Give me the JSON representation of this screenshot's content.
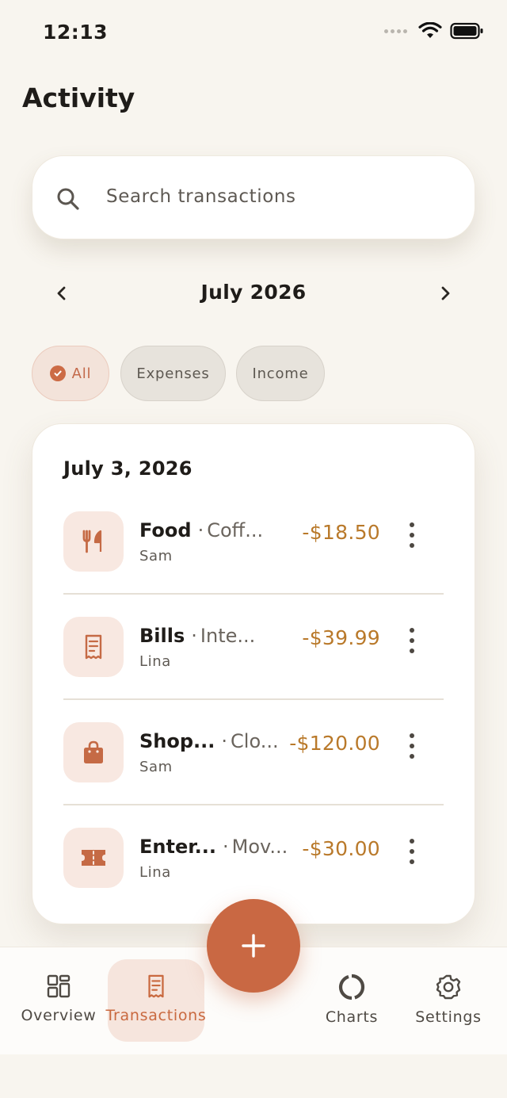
{
  "status_bar": {
    "time": "12:13"
  },
  "page": {
    "title": "Activity"
  },
  "search": {
    "placeholder": "Search transactions"
  },
  "month_selector": {
    "label": "July 2026"
  },
  "filters": [
    {
      "label": "All",
      "selected": true
    },
    {
      "label": "Expenses",
      "selected": false
    },
    {
      "label": "Income",
      "selected": false
    }
  ],
  "groups": [
    {
      "date": "July 3, 2026",
      "transactions": [
        {
          "category": "Food",
          "separator": "·",
          "note": "Coff...",
          "person": "Sam",
          "amount": "-$18.50",
          "icon": "fork-knife-icon"
        },
        {
          "category": "Bills",
          "separator": "·",
          "note": "Inte...",
          "person": "Lina",
          "amount": "-$39.99",
          "icon": "receipt-icon"
        },
        {
          "category": "Shop...",
          "separator": "·",
          "note": "Clo...",
          "person": "Sam",
          "amount": "-$120.00",
          "icon": "shopping-bag-icon"
        },
        {
          "category": "Enter...",
          "separator": "·",
          "note": "Mov...",
          "person": "Lina",
          "amount": "-$30.00",
          "icon": "ticket-icon"
        }
      ]
    }
  ],
  "nav": {
    "overview": "Overview",
    "transactions": "Transactions",
    "charts": "Charts",
    "settings": "Settings",
    "active": "transactions"
  },
  "colors": {
    "accent": "#c96843",
    "amount": "#b9792a",
    "background": "#f8f5ef",
    "chip_selected_bg": "#f3e3da",
    "icon_tile_bg": "#f8e8e1"
  }
}
